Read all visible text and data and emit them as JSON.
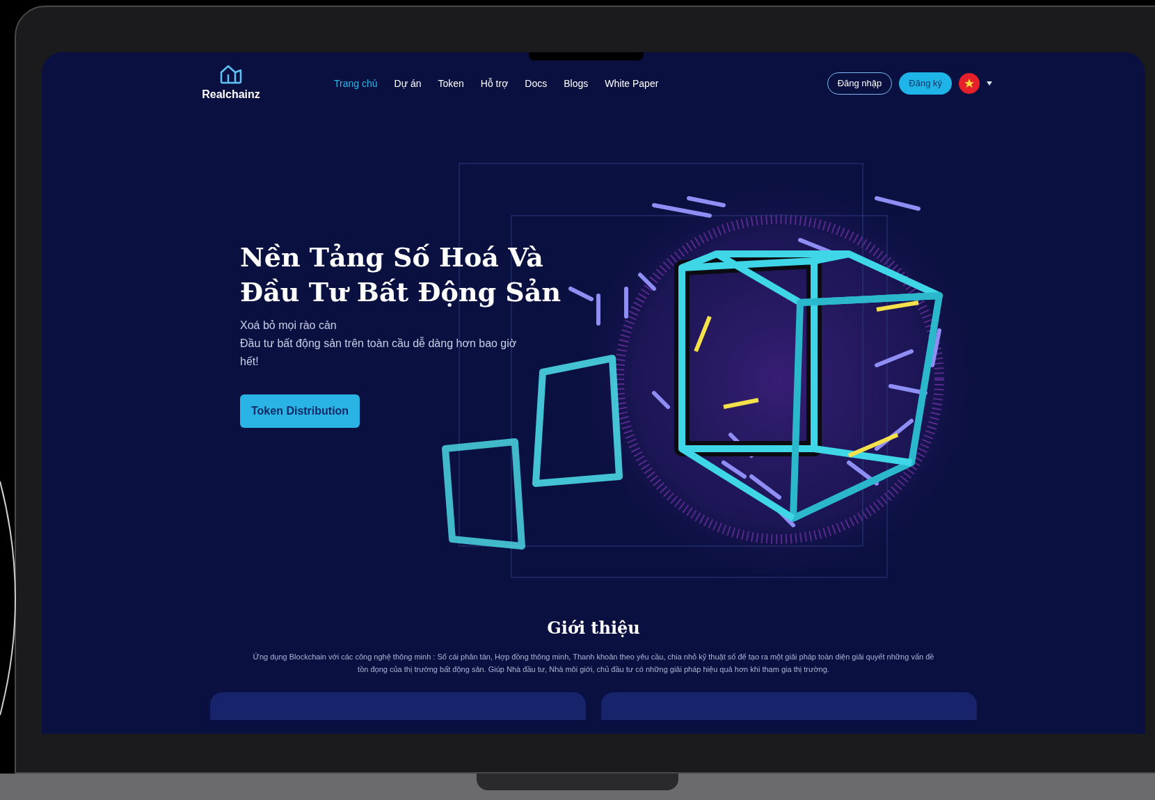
{
  "logo": {
    "name": "Realchainz"
  },
  "nav": [
    {
      "label": "Trang chủ",
      "selected": true
    },
    {
      "label": "Dự án",
      "selected": false
    },
    {
      "label": "Token",
      "selected": false
    },
    {
      "label": "Hỗ trợ",
      "selected": false
    },
    {
      "label": "Docs",
      "selected": false
    },
    {
      "label": "Blogs",
      "selected": false
    },
    {
      "label": "White Paper",
      "selected": false
    }
  ],
  "auth": {
    "login": "Đăng nhập",
    "register": "Đăng ký"
  },
  "hero": {
    "title_lines": [
      "Nền Tảng Số Hoá Và",
      "Đầu Tư Bất Động Sản"
    ],
    "subtitle_lines": [
      "Xoá bỏ mọi rào cản",
      "Đầu tư bất động sản trên toàn cầu dễ dàng hơn bao giờ hết!"
    ],
    "button": "Token Distribution"
  },
  "intro": {
    "title": "Giới thiệu",
    "text": "Ứng dụng Blockchain với các công nghệ thông minh : Sổ cái phân tán, Hợp đồng thông minh, Thanh khoản theo yêu cầu, chia nhỏ kỹ thuật số để tạo ra một giải pháp toàn diện giải quyết những vấn đề tồn đọng của thị trường bất động sản. Giúp Nhà đầu tư, Nhà môi giới, chủ đầu tư có những giải pháp hiệu quả hơn khi tham gia thị trường."
  }
}
